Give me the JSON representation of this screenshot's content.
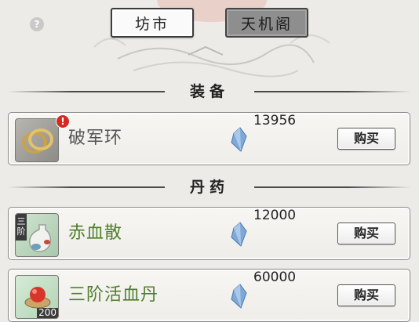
{
  "tabs": [
    {
      "label": "坊市",
      "active": true
    },
    {
      "label": "天机阁",
      "active": false
    }
  ],
  "sections": [
    {
      "title": "装备",
      "items": [
        {
          "name": "破军环",
          "icon": "bronze-rings-icon",
          "alert": "!",
          "price": "13956",
          "buy_label": "购买",
          "name_color": "#555555"
        }
      ]
    },
    {
      "title": "丹药",
      "items": [
        {
          "name": "赤血散",
          "icon": "medicine-bottle-icon",
          "tier": "三阶",
          "price": "12000",
          "buy_label": "购买",
          "name_color": "#4f7f2a"
        },
        {
          "name": "三阶活血丹",
          "icon": "red-pill-icon",
          "quantity": "200",
          "price": "60000",
          "buy_label": "购买",
          "name_color": "#4f7f2a"
        }
      ]
    }
  ],
  "help_icon": "?",
  "currency_icon": "spirit-crystal-icon",
  "colors": {
    "background": "#ecebe7",
    "alert": "#d42a22",
    "name_green": "#4f7f2a"
  }
}
